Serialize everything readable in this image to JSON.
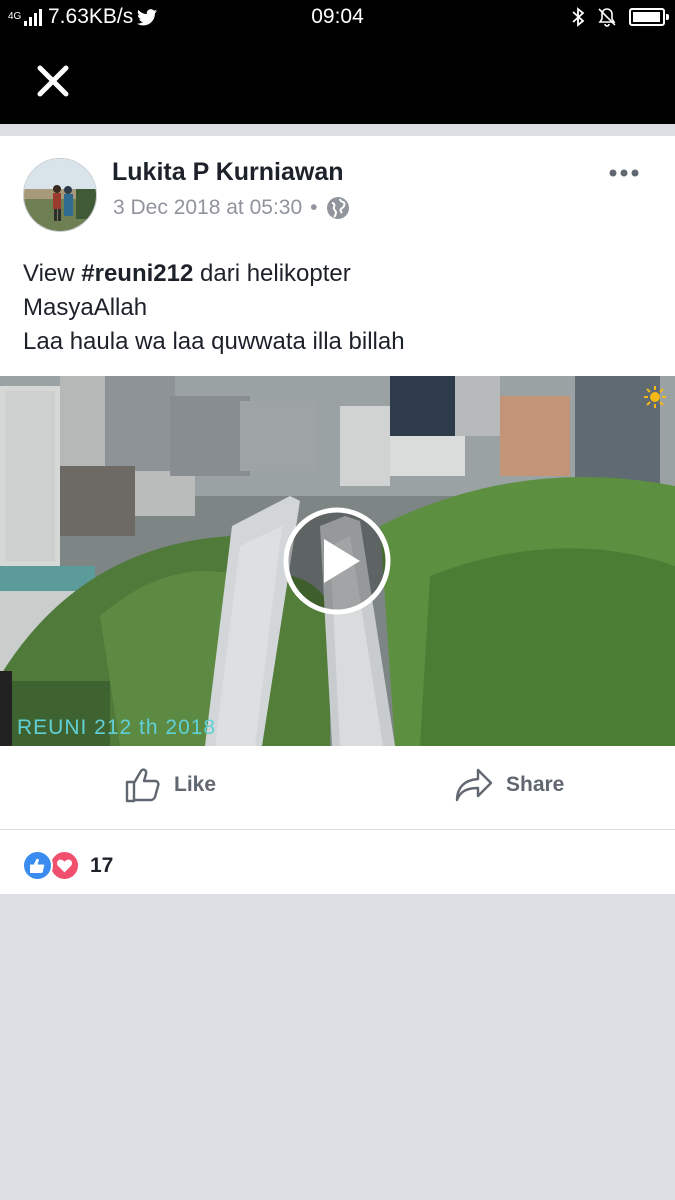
{
  "status_bar": {
    "network": "4G",
    "speed": "7.63KB/s",
    "time": "09:04",
    "battery_level": 0.95
  },
  "post": {
    "author": "Lukita P Kurniawan",
    "timestamp": "3 Dec 2018 at 05:30",
    "separator": "•",
    "audience_icon": "globe-icon",
    "text": {
      "line1_prefix": "View ",
      "hashtag": "#reuni212",
      "line1_suffix": " dari helikopter",
      "line2": "MasyaAllah",
      "line3": "Laa haula wa laa quwwata illa billah"
    },
    "video": {
      "watermark": "REUNI 212  th 2018",
      "play_icon": "play-icon"
    }
  },
  "actions": {
    "like_label": "Like",
    "share_label": "Share"
  },
  "reactions": {
    "count": "17",
    "types": [
      "like",
      "love"
    ]
  },
  "colors": {
    "like_blue": "#3b8cf0",
    "love_red": "#f0506e",
    "page_bg": "#dcdee3"
  }
}
